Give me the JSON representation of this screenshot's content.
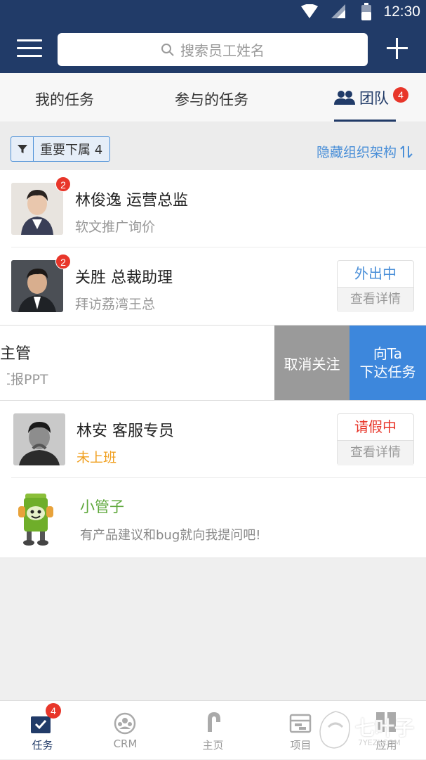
{
  "status_bar": {
    "time": "12:30"
  },
  "top_bar": {
    "search_placeholder": "搜索员工姓名"
  },
  "tabs": {
    "my_tasks": "我的任务",
    "joined_tasks": "参与的任务",
    "team": "团队",
    "team_badge": "4"
  },
  "filter": {
    "chip_label": "重要下属 4",
    "hide_org": "隐藏组织架构"
  },
  "members": [
    {
      "name": "林俊逸 运营总监",
      "sub": "软文推广询价",
      "badge": "2"
    },
    {
      "name": "关胜 总裁助理",
      "sub": "拜访荔湾王总",
      "badge": "2",
      "status": "外出中",
      "detail": "查看详情"
    }
  ],
  "swiped_member": {
    "name": "主管",
    "sub": "汇报PPT",
    "unfollow": "取消关注",
    "assign_line1": "向Ta",
    "assign_line2": "下达任务"
  },
  "member_lin_an": {
    "name": "林安 客服专员",
    "sub": "未上班",
    "status": "请假中",
    "detail": "查看详情"
  },
  "mascot": {
    "name": "小管子",
    "sub": "有产品建议和bug就向我提问吧!"
  },
  "bottom_nav": {
    "items": [
      {
        "label": "任务",
        "badge": "4"
      },
      {
        "label": "CRM"
      },
      {
        "label": "主页"
      },
      {
        "label": "项目"
      },
      {
        "label": "应用"
      }
    ]
  },
  "watermark": {
    "text": "七叶子",
    "small": "7YEZI.COM"
  },
  "colors": {
    "navy": "#213b68",
    "accent_blue": "#4a8fd8",
    "badge_red": "#e8362a",
    "status_red": "#e8362a",
    "status_orange": "#f0a020",
    "mascot_green": "#5fa83c"
  }
}
